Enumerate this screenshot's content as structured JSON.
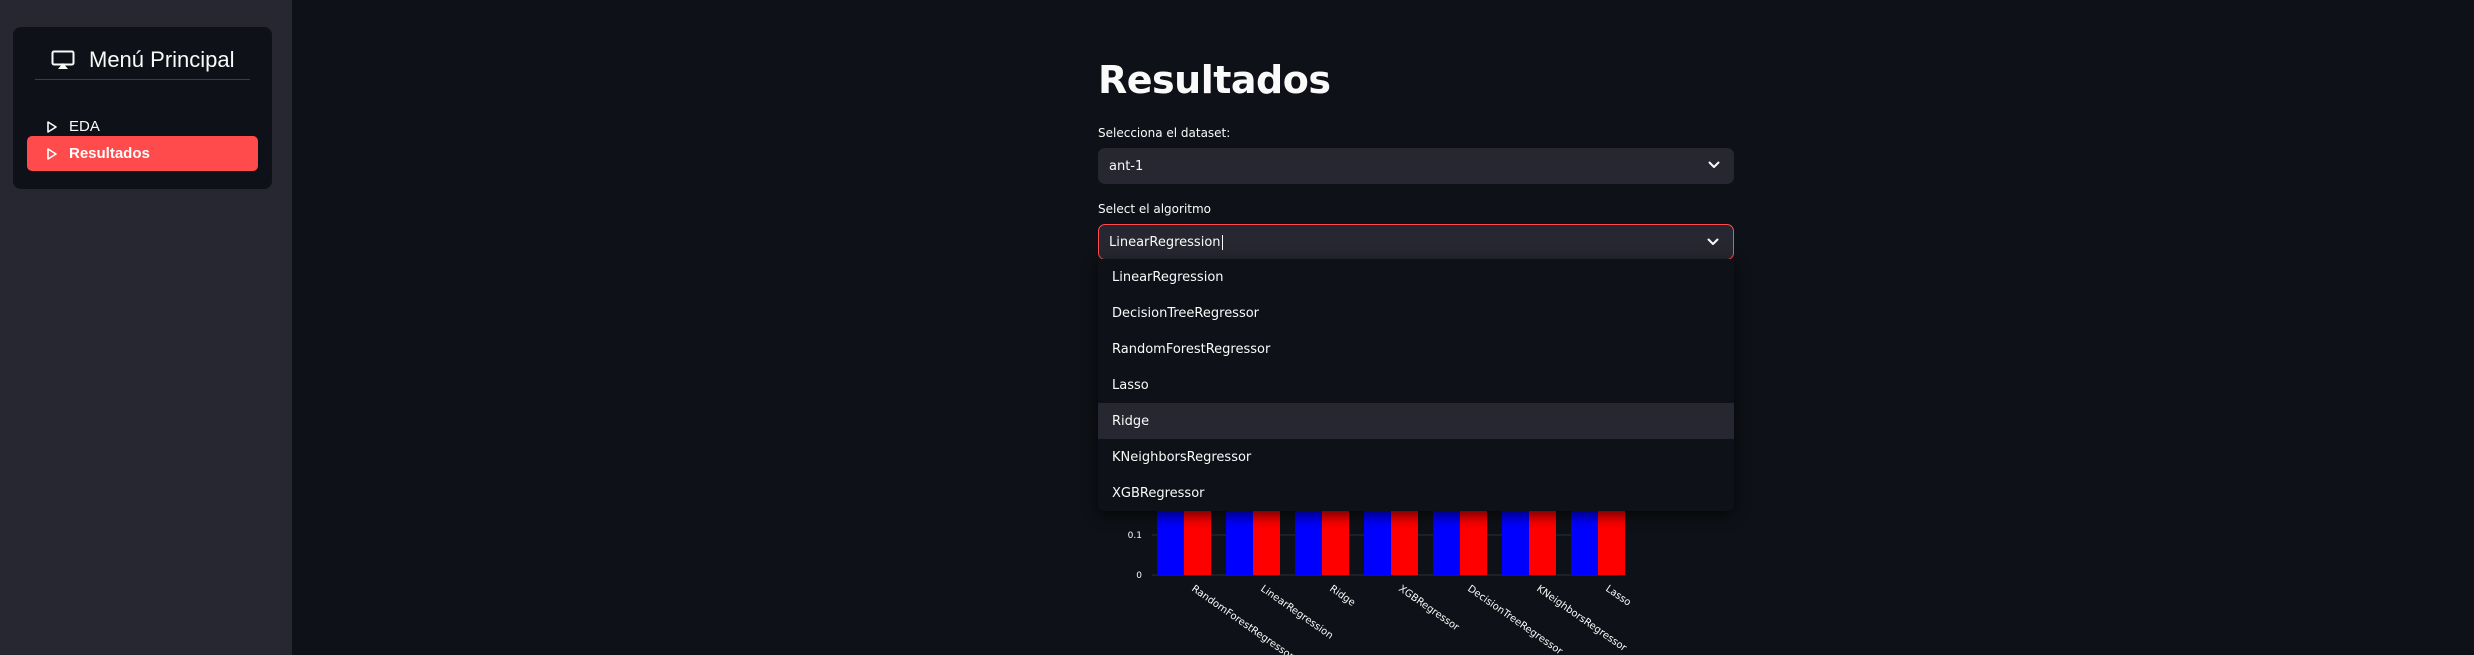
{
  "sidebar": {
    "title": "Menú Principal",
    "items": [
      {
        "label": "EDA",
        "active": false
      },
      {
        "label": "Resultados",
        "active": true
      }
    ],
    "accent_color": "#ff4b4b"
  },
  "main": {
    "title": "Resultados",
    "dataset_select": {
      "label": "Selecciona el dataset:",
      "value": "ant-1"
    },
    "algorithm_select": {
      "label": "Select el algoritmo",
      "value": "LinearRegression",
      "options": [
        "LinearRegression",
        "DecisionTreeRegressor",
        "RandomForestRegressor",
        "Lasso",
        "Ridge",
        "KNeighborsRegressor",
        "XGBRegressor"
      ],
      "hovered_option": "Ridge"
    }
  },
  "chart_data": {
    "type": "bar",
    "categories": [
      "RandomForestRegressor",
      "LinearRegression",
      "Ridge",
      "XGBRegressor",
      "DecisionTreeRegressor",
      "KNeighborsRegressor",
      "Lasso"
    ],
    "series": [
      {
        "color": "#0000ff",
        "values": [
          0.5,
          0.5,
          0.5,
          0.5,
          0.5,
          0.5,
          0.5
        ]
      },
      {
        "color": "#ff0000",
        "values": [
          0.5,
          0.5,
          0.5,
          0.5,
          0.5,
          0.5,
          0.5
        ]
      }
    ],
    "ytick_labels": [
      "0",
      "0.1"
    ],
    "yticks": [
      0,
      0.1
    ],
    "note": "upper part of the chart is hidden behind the open dropdown"
  }
}
